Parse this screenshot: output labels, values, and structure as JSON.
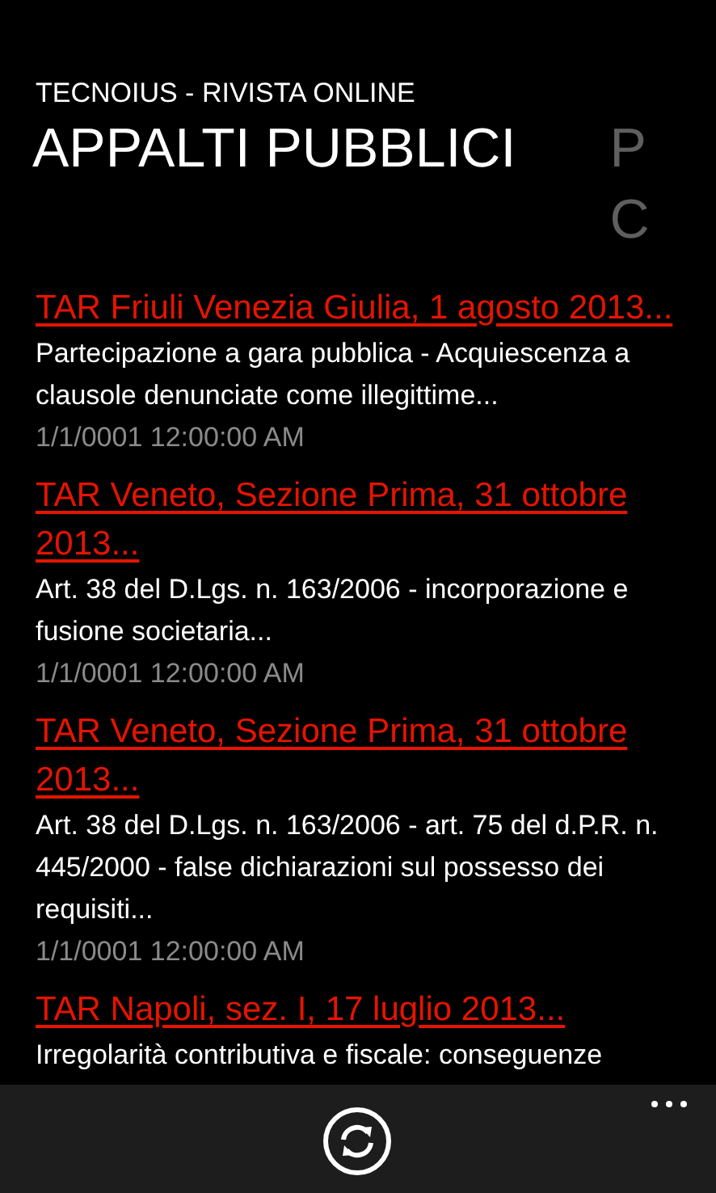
{
  "app_title": "TECNOIUS - RIVISTA ONLINE",
  "pivots": [
    {
      "label_lines": [
        "APPALTI PUBBLICI"
      ],
      "selected": true
    },
    {
      "label_lines": [
        "P",
        "C"
      ],
      "selected": false
    }
  ],
  "articles": [
    {
      "title": "TAR Friuli Venezia Giulia, 1 agosto 2013...",
      "summary": "Partecipazione a gara pubblica - Acquiescenza a clausole denunciate come illegittime...",
      "date": "1/1/0001 12:00:00 AM"
    },
    {
      "title": "TAR Veneto, Sezione Prima, 31 ottobre 2013...",
      "summary": "Art. 38 del D.Lgs. n. 163/2006 - incorporazione e fusione societaria...",
      "date": "1/1/0001 12:00:00 AM"
    },
    {
      "title": "TAR Veneto, Sezione Prima, 31 ottobre 2013...",
      "summary": "Art. 38 del D.Lgs. n. 163/2006 - art. 75 del d.P.R. n. 445/2000 - false dichiarazioni sul possesso dei requisiti...",
      "date": "1/1/0001 12:00:00 AM"
    },
    {
      "title": "TAR Napoli, sez. I, 17 luglio 2013...",
      "summary": "Irregolarità contributiva e fiscale: conseguenze"
    }
  ],
  "app_bar": {
    "buttons": [
      {
        "kind": "refresh"
      }
    ],
    "more": true
  }
}
